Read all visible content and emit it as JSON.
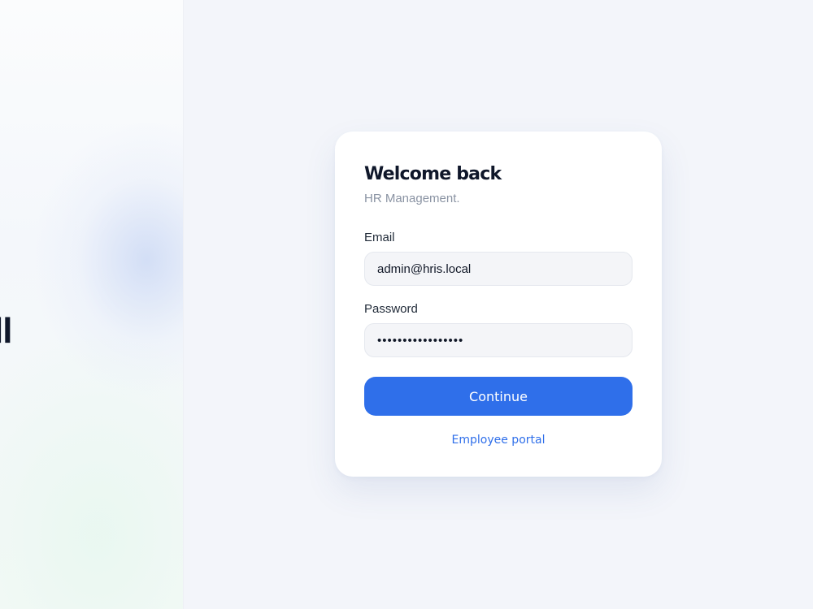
{
  "brand": {
    "mark": "ll"
  },
  "login": {
    "title": "Welcome back",
    "subtitle": "HR Management.",
    "email_label": "Email",
    "email_value": "admin@hris.local",
    "password_label": "Password",
    "password_value": "•••••••••••••••••",
    "continue_label": "Continue",
    "portal_link": "Employee portal"
  },
  "colors": {
    "accent": "#2f6fea",
    "background": "#f3f5fa",
    "card": "#ffffff",
    "title": "#0f172a",
    "muted": "#8a93a3"
  }
}
